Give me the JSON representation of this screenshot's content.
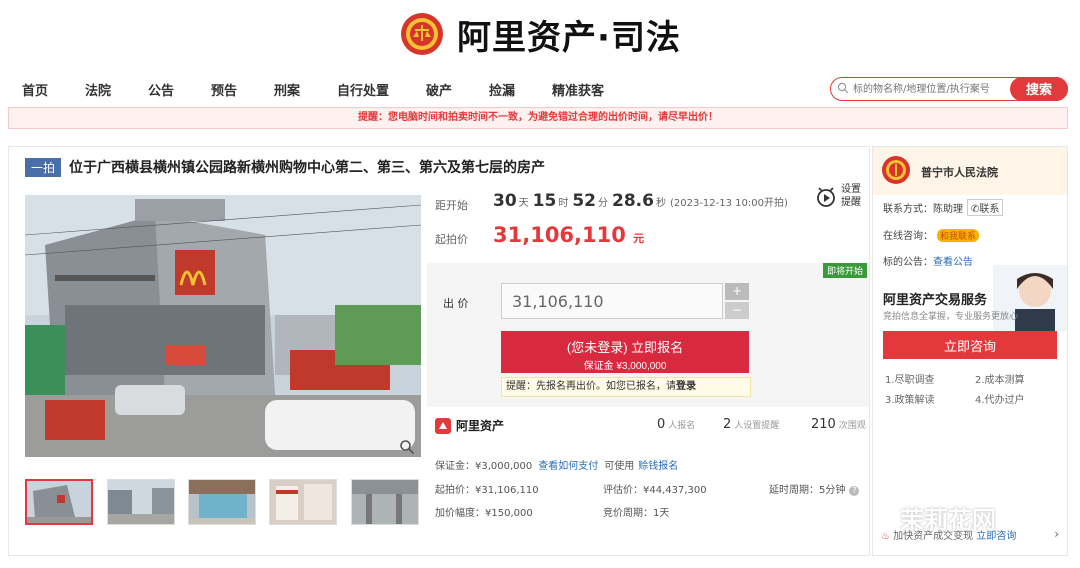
{
  "header": {
    "brand": "阿里资产·司法"
  },
  "nav": {
    "items": [
      "首页",
      "法院",
      "公告",
      "预告",
      "刑案",
      "自行处置",
      "破产",
      "捡漏",
      "精准获客"
    ]
  },
  "search": {
    "placeholder": "标的物名称/地理位置/执行案号",
    "button": "搜索"
  },
  "notice": "提醒：您电脑时间和拍卖时间不一致，为避免错过合理的出价时间，请尽早出价！",
  "lot": {
    "tag": "一拍",
    "title": "位于广西横县横州镇公园路新横州购物中心第二、第三、第六及第七层的房产",
    "countdown_label": "距开始",
    "days": "30",
    "days_unit": "天",
    "hours": "15",
    "hours_unit": "时",
    "minutes": "52",
    "minutes_unit": "分",
    "seconds": "28.6",
    "seconds_unit": "秒",
    "start_time": "(2023-12-13 10:00开拍)",
    "setting_label": "设置提醒",
    "start_price_label": "起拍价",
    "start_price": "31,106,110",
    "start_price_unit": "元",
    "badge": "即将开始",
    "bid_label": "出 价",
    "bid_value": "31,106,110",
    "signup_main": "(您未登录) 立即报名",
    "signup_sub": "保证金 ¥3,000,000",
    "tip_prefix": "提醒：先报名再出价。如您已报名，请",
    "tip_link": "登录"
  },
  "stats": {
    "brand": "阿里资产",
    "signups": "0",
    "signups_unit": "人报名",
    "reminders": "2",
    "reminders_unit": "人设置提醒",
    "views": "210",
    "views_unit": "次围观"
  },
  "details": {
    "deposit": "保证金：¥3,000,000",
    "how_to_pay": "查看如何支付",
    "may_use": "可使用",
    "credit_link": "赊钱报名",
    "start_price": "起拍价：¥31,106,110",
    "appraisal": "评估价：¥44,437,300",
    "extension": "延时周期：5分钟",
    "increment": "加价幅度：¥150,000",
    "cycle": "竞价周期：1天"
  },
  "side": {
    "court": "普宁市人民法院",
    "contact_label": "联系方式：",
    "contact_name": "陈助理",
    "contact_btn": "联系",
    "chat_label": "在线咨询：",
    "chat_btn": "和我联系",
    "notice_label": "标的公告：",
    "notice_link": "查看公告",
    "ad_title": "阿里资产交易服务",
    "ad_sub": "竞拍信息全掌握，专业服务更放心",
    "ad_btn": "立即咨询",
    "services": [
      "1.尽职调查",
      "2.成本测算",
      "3.政策解读",
      "4.代办过户"
    ],
    "foot_text": "加快资产成交变现",
    "foot_link": "立即咨询"
  },
  "watermark": "茉莉花网",
  "colors": {
    "accent": "#e4393c",
    "title_tag": "#4a6ea9",
    "badge": "#3a9a3a"
  }
}
